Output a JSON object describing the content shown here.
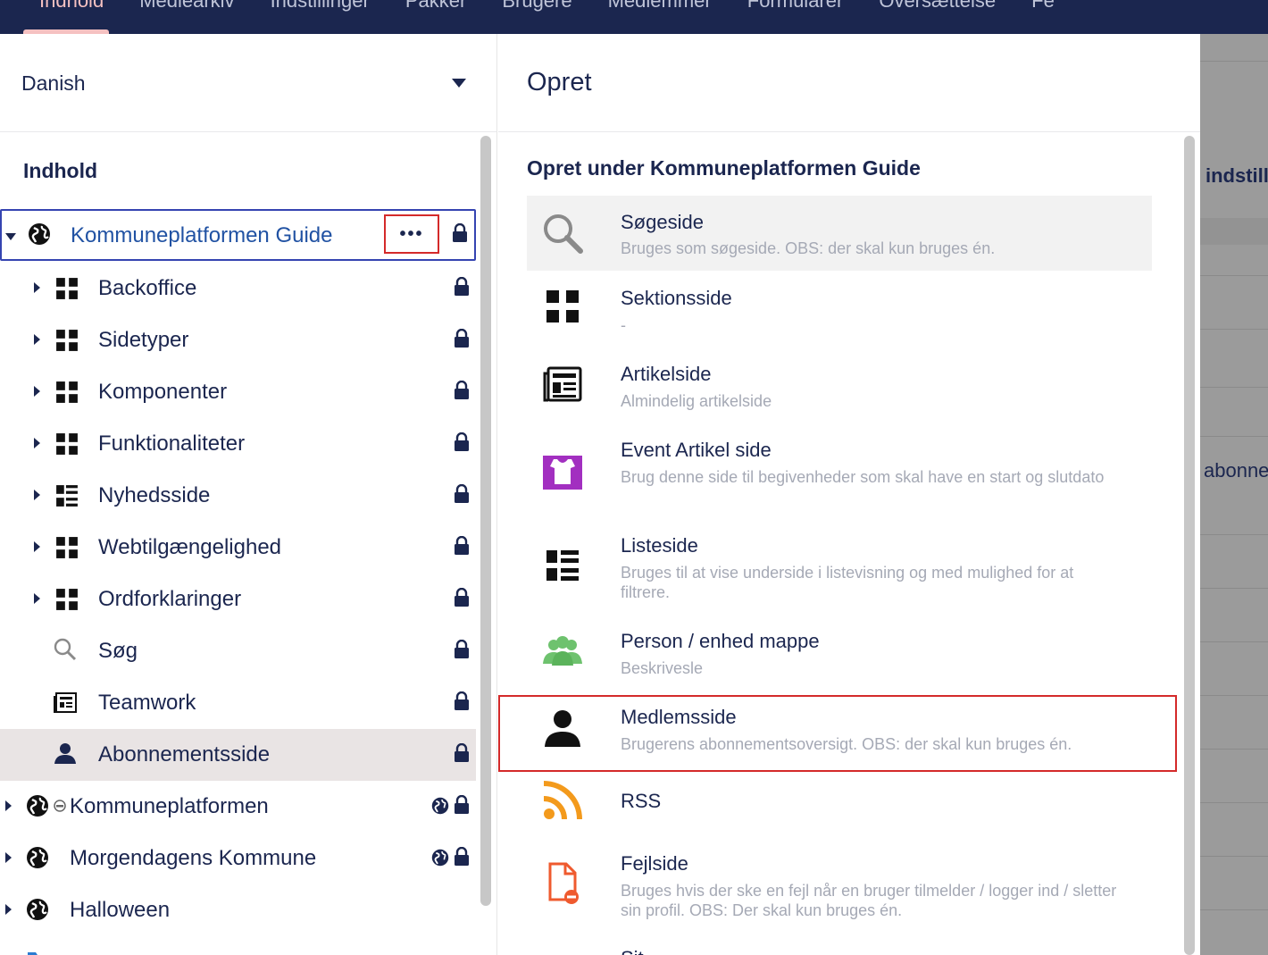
{
  "topnav": {
    "items": [
      "Indhold",
      "Mediearkiv",
      "Indstillinger",
      "Pakker",
      "Brugere",
      "Medlemmer",
      "Formularer",
      "Oversættelse",
      "Fe"
    ]
  },
  "backdrop": {
    "text1": "indstill",
    "text2": "abonne"
  },
  "tree": {
    "language": "Danish",
    "heading": "Indhold",
    "more_button": "•••",
    "items": [
      {
        "label": "Kommuneplatformen Guide"
      },
      {
        "label": "Backoffice"
      },
      {
        "label": "Sidetyper"
      },
      {
        "label": "Komponenter"
      },
      {
        "label": "Funktionaliteter"
      },
      {
        "label": "Nyhedsside"
      },
      {
        "label": "Webtilgængelighed"
      },
      {
        "label": "Ordforklaringer"
      },
      {
        "label": "Søg"
      },
      {
        "label": "Teamwork"
      },
      {
        "label": "Abonnementsside"
      },
      {
        "label": "Kommuneplatformen"
      },
      {
        "label": "Morgendagens Kommune"
      },
      {
        "label": "Halloween"
      }
    ]
  },
  "create": {
    "title": "Opret",
    "subtitle": "Opret under Kommuneplatformen Guide",
    "doc_types": [
      {
        "name": "Søgeside",
        "desc": "Bruges som søgeside. OBS: der skal kun bruges én.",
        "icon": "search-icon"
      },
      {
        "name": "Sektionsside",
        "desc": "-",
        "icon": "section-grid-icon"
      },
      {
        "name": "Artikelside",
        "desc": "Almindelig artikelside",
        "icon": "article-icon"
      },
      {
        "name": "Event Artikel side",
        "desc": "Brug denne side til begivenheder som skal have en start og slutdato",
        "icon": "event-icon"
      },
      {
        "name": "Listeside",
        "desc": "Bruges til at vise underside i listevisning og med mulighed for at filtrere.",
        "icon": "list-icon"
      },
      {
        "name": "Person / enhed mappe",
        "desc": "Beskrivesle",
        "icon": "people-icon"
      },
      {
        "name": "Medlemsside",
        "desc": "Brugerens abonnementsoversigt. OBS: der skal kun bruges én.",
        "icon": "user-icon"
      },
      {
        "name": "RSS",
        "desc": "",
        "icon": "rss-icon"
      },
      {
        "name": "Fejlside",
        "desc": "Bruges hvis der ske en fejl når en bruger tilmelder / logger ind / sletter sin profil. OBS: Der skal kun bruges én.",
        "icon": "error-page-icon"
      },
      {
        "name": "Sit",
        "desc": "",
        "icon": "site-icon"
      }
    ]
  },
  "colors": {
    "topbar": "#1b264f",
    "accent_red": "#d42a2a",
    "selection_blue": "#3544b1",
    "event_purple": "#a22fc0",
    "rss_orange": "#f39a1c",
    "people_green": "#6ec26e",
    "error_orange": "#ef5a2e"
  }
}
